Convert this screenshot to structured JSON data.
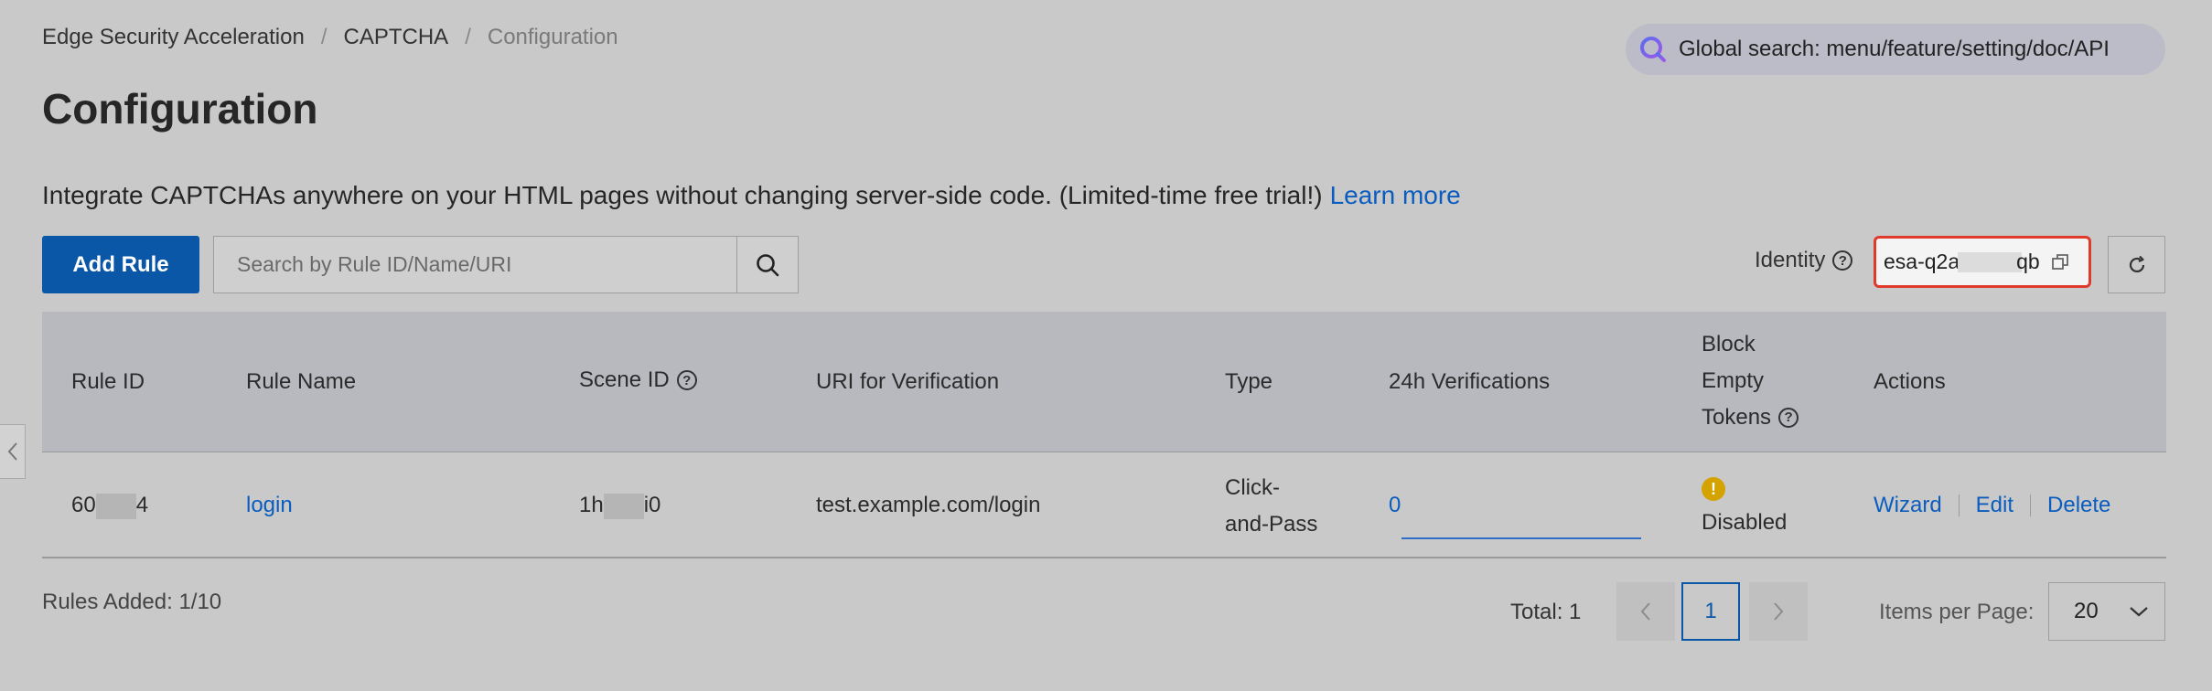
{
  "breadcrumb": {
    "items": [
      "Edge Security Acceleration",
      "CAPTCHA"
    ],
    "current": "Configuration",
    "separator": "/"
  },
  "global_search": {
    "label": "Global search: menu/feature/setting/doc/API"
  },
  "page": {
    "title": "Configuration",
    "intro": "Integrate CAPTCHAs anywhere on your HTML pages without changing server-side code. (Limited-time free trial!)",
    "learn_more": "Learn more"
  },
  "toolbar": {
    "add_rule": "Add Rule",
    "search_placeholder": "Search by Rule ID/Name/URI",
    "identity_label": "Identity",
    "identity_prefix": "esa-q2a",
    "identity_suffix": "qb"
  },
  "table": {
    "headers": {
      "rule_id": "Rule ID",
      "rule_name": "Rule Name",
      "scene_id": "Scene ID",
      "uri": "URI for Verification",
      "type": "Type",
      "verifications": "24h Verifications",
      "block_empty_line1": "Block",
      "block_empty_line2": "Empty",
      "block_empty_line3": "Tokens",
      "actions": "Actions"
    },
    "rows": [
      {
        "rule_id_prefix": "60",
        "rule_id_suffix": "4",
        "rule_name": "login",
        "scene_id_prefix": "1h",
        "scene_id_suffix": "i0",
        "uri": "test.example.com/login",
        "type_line1": "Click-",
        "type_line2": "and-Pass",
        "verifications": "0",
        "block_status": "Disabled",
        "actions": {
          "wizard": "Wizard",
          "edit": "Edit",
          "delete": "Delete"
        }
      }
    ]
  },
  "footer": {
    "rules_added": "Rules Added: 1/10",
    "total": "Total: 1",
    "current_page": "1",
    "items_per_page_label": "Items per Page:",
    "items_per_page_value": "20"
  },
  "colors": {
    "primary": "#0a57a8",
    "link": "#0a5dbf",
    "highlight_border": "#e03a2a",
    "warning": "#d4a300"
  }
}
